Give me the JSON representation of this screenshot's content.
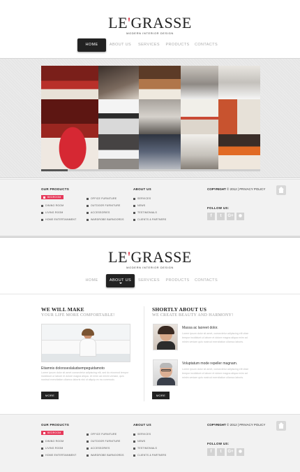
{
  "brand": {
    "name_prefix": "LE",
    "apostrophe": "'",
    "name_suffix": "GRASSE",
    "tagline": "MODERN INTERIOR DESIGN",
    "accent_color": "#d8293b"
  },
  "nav": {
    "items": [
      "HOME",
      "ABOUT US",
      "SERVICES",
      "PRODUCTS",
      "CONTACTS"
    ]
  },
  "screen1": {
    "active_nav": "HOME"
  },
  "screen2": {
    "active_nav": "ABOUT US"
  },
  "slider": {
    "progress": 0.12
  },
  "footer": {
    "products_heading": "OUR PRODUCTS",
    "products_col1": [
      "BEDROOM",
      "DINING ROOM",
      "LIVING ROOM",
      "HOME ENTERTAINMENT"
    ],
    "products_col2": [
      "OFFICE FURNITURE",
      "OUTDOOR FURNITURE",
      "ACCESSORIES",
      "WARDROBE BARNOORDS"
    ],
    "highlight_item": "BEDROOM",
    "highlight_color": "#e63a5b",
    "about_heading": "ABOUT US",
    "about_items": [
      "SERVICES",
      "NEWS",
      "TESTIMONIALS",
      "CLIENTS & PARTNERS"
    ],
    "copyright_label": "COPYRIGHT",
    "copyright_text": "© 2012 | PRIVACY POLICY",
    "follow_label": "FOLLOW US:",
    "social_icons": [
      "f",
      "t",
      "G+",
      "rss"
    ]
  },
  "about": {
    "left_title": "WE WILL MAKE",
    "left_subtitle": "YOUR LIFE MORE COMFORTABLE!",
    "left_link": "Etiamnis dolorsseslaludsempeguidamoto",
    "left_body": [
      "Lorem ipsum dolor sit amet consectetur adipiscing elit, sed do eiusmod tempor",
      "incididunt ut labore et dolore magna aliqua. Ut enim ad minim veniam, quis",
      "nostrud exercitation ullamco laboris nisi ut aliquip ex ea commodo."
    ],
    "right_title": "SHORTLY ABOUT US",
    "right_subtitle": "WE CREATE BEAUTY AND HARMONY!",
    "items": [
      {
        "heading": "Massa ac laoreet dolor.",
        "body": [
          "Lorem ipsum dolor sit amet, consectetur adipiscing elit vitae",
          "tempor incididunt ut labore et dolore magna aliqua enim ad",
          "minim veniam quis nostrud exercitation ullamco laboris."
        ]
      },
      {
        "heading": "Voluptatum mode repeller magnam.",
        "body": [
          "Lorem ipsum dolor sit amet, consectetur adipiscing elit vitae",
          "tempor incididunt ut labore et dolore magna aliqua enim ad",
          "minim veniam quis nostrud exercitation ullamco laboris."
        ]
      }
    ],
    "more_label": "MORE"
  }
}
